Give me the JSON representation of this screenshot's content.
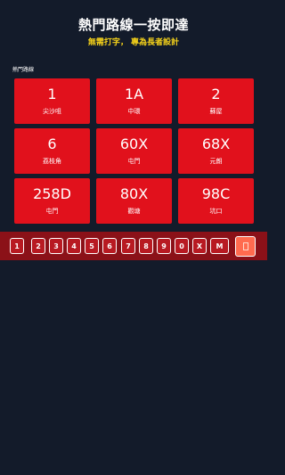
{
  "header": {
    "title": "熱門路線一按即達",
    "subtitle": "無需打字， 專為長者設計"
  },
  "section": {
    "label": "熱門路線"
  },
  "routes": [
    {
      "number": "1",
      "destination": "尖沙咀"
    },
    {
      "number": "1A",
      "destination": "中環"
    },
    {
      "number": "2",
      "destination": "蘇屋"
    },
    {
      "number": "6",
      "destination": "荔枝角"
    },
    {
      "number": "60X",
      "destination": "屯門"
    },
    {
      "number": "68X",
      "destination": "元朗"
    },
    {
      "number": "258D",
      "destination": "屯門"
    },
    {
      "number": "80X",
      "destination": "觀塘"
    },
    {
      "number": "98C",
      "destination": "坑口"
    }
  ],
  "keypad": {
    "keys": [
      "1",
      "2",
      "3",
      "4",
      "5",
      "6",
      "7",
      "8",
      "9",
      "0",
      "X",
      "M"
    ],
    "backspace_icon": "backspace-icon",
    "colors": {
      "bar": "#8b1118",
      "key": "#b81a22",
      "backspace": "#ff6b4f"
    }
  },
  "colors": {
    "background": "#131b2a",
    "accent": "#e1111c",
    "subtitle": "#f5d21a"
  }
}
